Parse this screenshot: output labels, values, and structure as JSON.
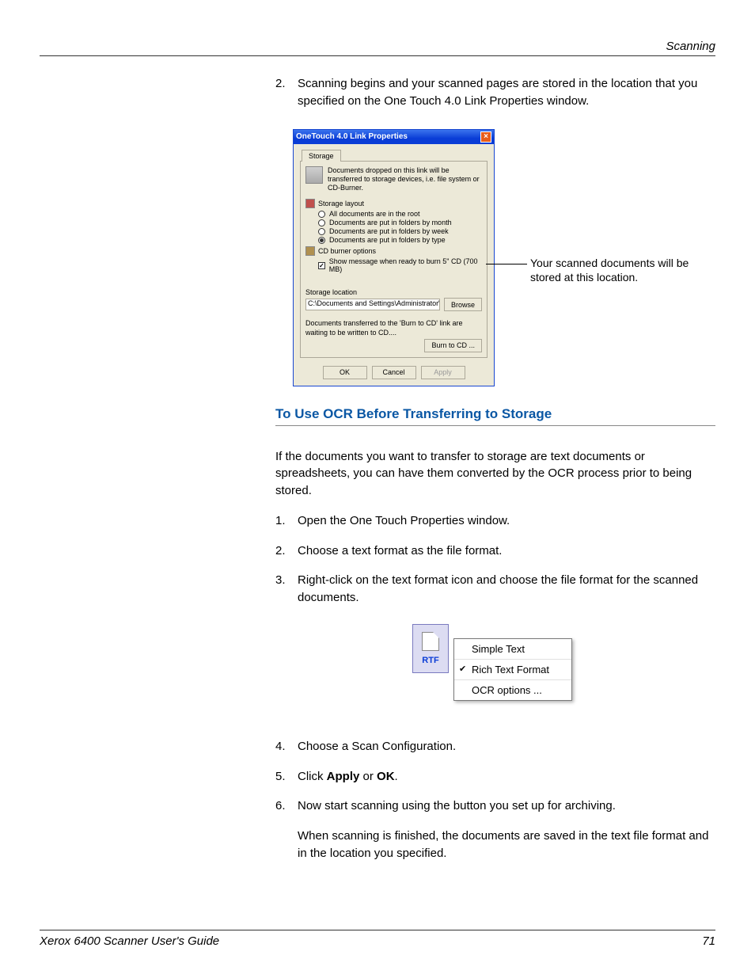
{
  "header": {
    "section": "Scanning"
  },
  "intro_step": {
    "num": "2.",
    "text": "Scanning begins and your scanned pages are stored in the location that you specified on the One Touch 4.0 Link Properties window."
  },
  "dialog": {
    "title": "OneTouch 4.0 Link Properties",
    "tab": "Storage",
    "desc": "Documents dropped on this link will be transferred to storage devices, i.e. file system or CD-Burner.",
    "storage_layout_label": "Storage layout",
    "radios": {
      "r1": "All documents are in the root",
      "r2": "Documents are put in folders by month",
      "r3": "Documents are put in folders by week",
      "r4": "Documents are put in folders by type"
    },
    "cd_label": "CD burner options",
    "cd_check": "Show message when ready to burn 5\" CD (700 MB)",
    "storage_location_label": "Storage location",
    "storage_path": "C:\\Documents and Settings\\Administrator\\My Do",
    "browse": "Browse",
    "burn_note": "Documents transferred to the 'Burn to CD' link are waiting to be written to CD....",
    "burn_btn": "Burn to CD ...",
    "ok": "OK",
    "cancel": "Cancel",
    "apply": "Apply"
  },
  "callout": "Your scanned documents will be stored at this location.",
  "section_heading": "To Use OCR Before Transferring to Storage",
  "ocr_intro": "If the documents you want to transfer to storage are text documents or spreadsheets, you can have them converted by the OCR process prior to being stored.",
  "ocr_steps": {
    "s1": {
      "n": "1.",
      "t": "Open the One Touch Properties window."
    },
    "s2": {
      "n": "2.",
      "t": "Choose a text format as the file format."
    },
    "s3": {
      "n": "3.",
      "t": "Right-click on the text format icon and choose the file format for the scanned documents."
    },
    "s4": {
      "n": "4.",
      "t": "Choose a Scan Configuration."
    },
    "s5": {
      "n": "5.",
      "pre": "Click ",
      "b1": "Apply",
      "mid": " or ",
      "b2": "OK",
      "post": "."
    },
    "s6": {
      "n": "6.",
      "t": "Now start scanning using the button you set up for archiving."
    }
  },
  "ocr_result": "When scanning is finished, the documents are saved in the text file format and in the location you specified.",
  "menu": {
    "rtf": "RTF",
    "m1": "Simple Text",
    "m2": "Rich Text Format",
    "m3": "OCR options ..."
  },
  "footer": {
    "left": "Xerox 6400 Scanner User's Guide",
    "right": "71"
  }
}
